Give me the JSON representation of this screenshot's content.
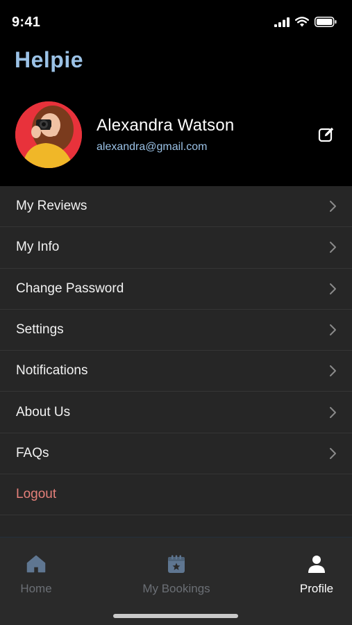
{
  "status_bar": {
    "time": "9:41"
  },
  "app": {
    "brand": "Helpie"
  },
  "profile": {
    "name": "Alexandra Watson",
    "email": "alexandra@gmail.com"
  },
  "menu": {
    "items": [
      {
        "label": "My Reviews"
      },
      {
        "label": "My Info"
      },
      {
        "label": "Change Password"
      },
      {
        "label": "Settings"
      },
      {
        "label": "Notifications"
      },
      {
        "label": "About Us"
      },
      {
        "label": "FAQs"
      }
    ],
    "logout_label": "Logout"
  },
  "tab_bar": {
    "home_label": "Home",
    "bookings_label": "My Bookings",
    "profile_label": "Profile"
  },
  "colors": {
    "brand": "#9bc2e6",
    "logout": "#e5807a",
    "menu_bg": "#262626",
    "tab_inactive": "#6b6f75",
    "tab_active": "#ffffff"
  }
}
